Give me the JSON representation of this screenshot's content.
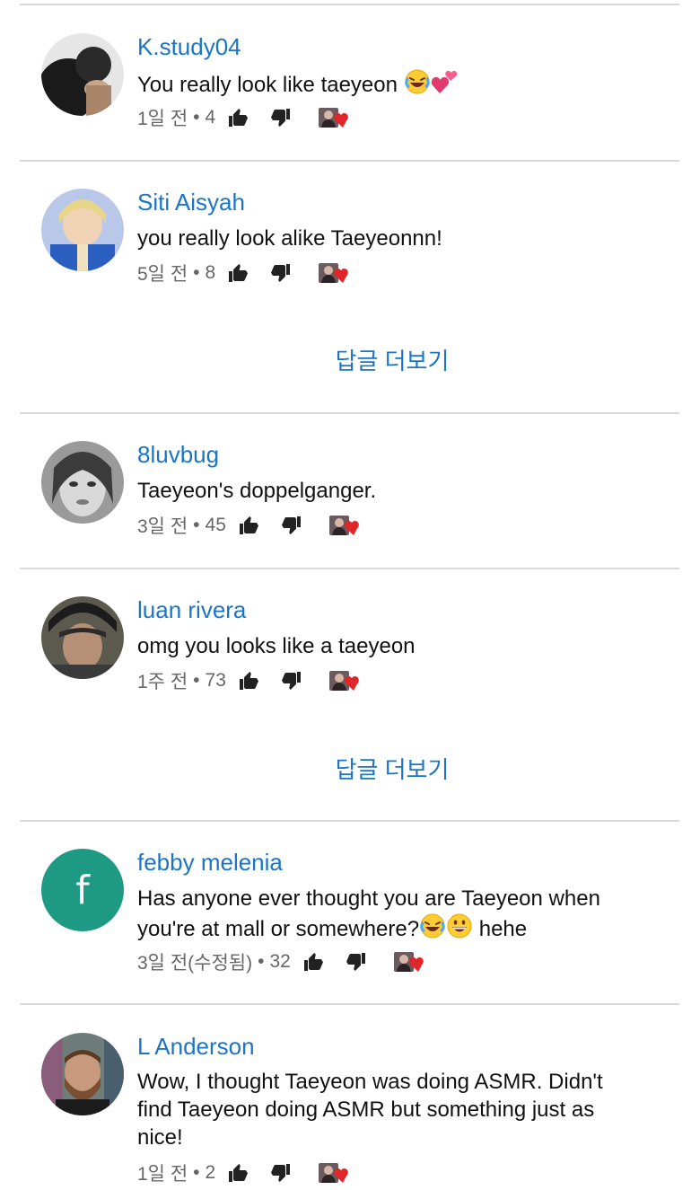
{
  "comments": [
    {
      "author": "K.study04",
      "text": "You really look like taeyeon ",
      "time": "1일 전",
      "likes": "4"
    },
    {
      "author": "Siti Aisyah",
      "text": "you really look alike Taeyeonnn!",
      "time": "5일 전",
      "likes": "8"
    },
    {
      "author": "8luvbug",
      "text": "Taeyeon's doppelganger.",
      "time": "3일 전",
      "likes": "45"
    },
    {
      "author": "luan rivera",
      "text": "omg you looks like a taeyeon",
      "time": "1주 전",
      "likes": "73"
    },
    {
      "author": "febby melenia",
      "avatar_letter": "f",
      "text_line1": "Has anyone ever thought you are Taeyeon when",
      "text_line2": "you're at mall or somewhere?",
      "text_tail": " hehe",
      "time": "3일 전(수정됨)",
      "likes": "32"
    },
    {
      "author": "L Anderson",
      "text": "Wow, I thought Taeyeon was doing ASMR. Didn't\nfind Taeyeon doing ASMR but something just as\nnice!",
      "time": "1일 전",
      "likes": "2"
    }
  ],
  "more_replies_label": "답글 더보기",
  "meta_separator": "•",
  "icons": [
    "thumb-up-icon",
    "thumb-down-icon",
    "creator-heart-icon",
    "laughing-emoji",
    "two-hearts-emoji",
    "grinning-emoji"
  ],
  "colors": {
    "link": "#1b75c7",
    "divider": "#d9d9d9",
    "heart": "#e1262a",
    "avatar_f": "#1e9a84"
  }
}
